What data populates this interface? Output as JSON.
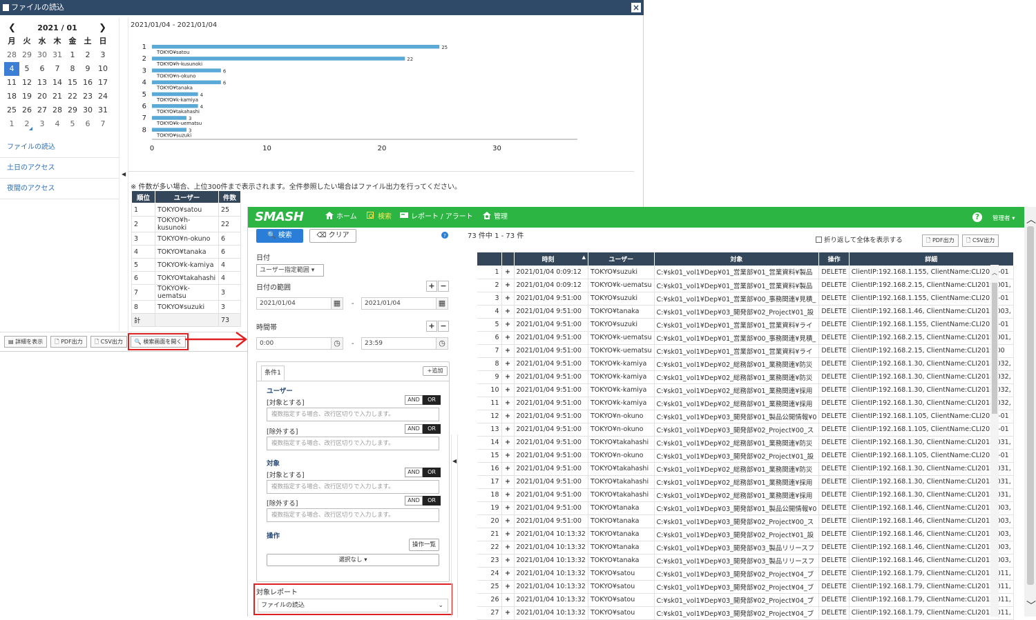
{
  "report_window": {
    "title": "ファイルの読込",
    "close": "×",
    "calendar": {
      "month_label": "2021 / 01",
      "prev": "❮",
      "next": "❯",
      "weekdays": [
        "月",
        "火",
        "水",
        "木",
        "金",
        "土",
        "日"
      ],
      "days": [
        {
          "d": "28",
          "m": true
        },
        {
          "d": "29",
          "m": true
        },
        {
          "d": "30",
          "m": true
        },
        {
          "d": "31",
          "m": true
        },
        {
          "d": "1"
        },
        {
          "d": "2"
        },
        {
          "d": "3"
        },
        {
          "d": "4",
          "sel": true
        },
        {
          "d": "5"
        },
        {
          "d": "6"
        },
        {
          "d": "7"
        },
        {
          "d": "8"
        },
        {
          "d": "9"
        },
        {
          "d": "10"
        },
        {
          "d": "11"
        },
        {
          "d": "12"
        },
        {
          "d": "13"
        },
        {
          "d": "14"
        },
        {
          "d": "15"
        },
        {
          "d": "16"
        },
        {
          "d": "17"
        },
        {
          "d": "18"
        },
        {
          "d": "19"
        },
        {
          "d": "20"
        },
        {
          "d": "21"
        },
        {
          "d": "22"
        },
        {
          "d": "23"
        },
        {
          "d": "24"
        },
        {
          "d": "25"
        },
        {
          "d": "26"
        },
        {
          "d": "27"
        },
        {
          "d": "28"
        },
        {
          "d": "29"
        },
        {
          "d": "30"
        },
        {
          "d": "31"
        },
        {
          "d": "1",
          "m": true
        },
        {
          "d": "2",
          "m": true,
          "mark": true
        },
        {
          "d": "3",
          "m": true
        },
        {
          "d": "4",
          "m": true
        },
        {
          "d": "5",
          "m": true
        },
        {
          "d": "6",
          "m": true
        },
        {
          "d": "7",
          "m": true
        }
      ]
    },
    "side_links": [
      "ファイルの読込",
      "土日のアクセス",
      "夜間のアクセス"
    ],
    "date_range": "2021/01/04 - 2021/01/04",
    "note": "※ 件数が多い場合、上位300件まで表示されます。全件参照したい場合はファイル出力を行ってください。",
    "rank_table": {
      "headers": [
        "順位",
        "ユーザー",
        "件数"
      ],
      "rows": [
        [
          "1",
          "TOKYO¥satou",
          "25"
        ],
        [
          "2",
          "TOKYO¥h-kusunoki",
          "22"
        ],
        [
          "3",
          "TOKYO¥n-okuno",
          "6"
        ],
        [
          "4",
          "TOKYO¥tanaka",
          "6"
        ],
        [
          "5",
          "TOKYO¥k-kamiya",
          "4"
        ],
        [
          "6",
          "TOKYO¥takahashi",
          "4"
        ],
        [
          "7",
          "TOKYO¥k-uematsu",
          "3"
        ],
        [
          "8",
          "TOKYO¥suzuki",
          "3"
        ]
      ],
      "total_label": "計",
      "total_value": "73"
    },
    "buttons": {
      "detail": "詳細を表示",
      "pdf": "PDF出力",
      "csv": "CSV出力",
      "open_search": "検索画面を開く"
    }
  },
  "chart_data": {
    "type": "bar",
    "orientation": "horizontal",
    "categories": [
      "1",
      "2",
      "3",
      "4",
      "5",
      "6",
      "7",
      "8"
    ],
    "bar_labels": [
      "TOKYO¥satou",
      "TOKYO¥h-kusunoki",
      "TOKYO¥n-okuno",
      "TOKYO¥tanaka",
      "TOKYO¥k-kamiya",
      "TOKYO¥takahashi",
      "TOKYO¥k-uematsu",
      "TOKYO¥suzuki"
    ],
    "values": [
      25,
      22,
      6,
      6,
      4,
      4,
      3,
      3
    ],
    "xlim": [
      0,
      37
    ],
    "xticks": [
      0,
      10,
      20,
      30
    ],
    "bar_color": "#5aa9d6",
    "grid": false
  },
  "app": {
    "logo": "SMASH",
    "nav": {
      "home": "ホーム",
      "search": "検索",
      "report": "レポート / アラート",
      "admin_menu": "管理",
      "help": "?",
      "user": "管理者 ▾"
    },
    "form": {
      "search_btn": "検索",
      "clear_btn": "クリア",
      "date_label": "日付",
      "date_mode": "ユーザー指定範囲",
      "date_range_label": "日付の範囲",
      "date_from": "2021/01/04",
      "date_to": "2021/01/04",
      "range_sep": "-",
      "time_label": "時間帯",
      "time_from": "0:00",
      "time_to": "23:59",
      "cond_tab": "条件1",
      "add_btn": "追加",
      "user_section": "ユーザー",
      "target_section": "対象",
      "op_section": "操作",
      "include_label": "[対象とする]",
      "exclude_label": "[除外する]",
      "and": "AND",
      "or": "OR",
      "multi_placeholder": "複数指定する場合、改行区切りで入力します。",
      "op_list_btn": "操作一覧",
      "op_select": "選択なし ▾",
      "report_label": "対象レポート",
      "report_value": "ファイルの読込"
    },
    "results": {
      "count_text": "73 件中 1 - 73 件",
      "wrap_label": "折り返して全体を表示する",
      "pdf": "PDF出力",
      "csv": "CSV出力",
      "headers": [
        "",
        "",
        "時刻",
        "ユーザー",
        "対象",
        "操作",
        "詳細"
      ],
      "rows": [
        [
          "1",
          "2021/01/04 0:09:12",
          "TOKYO¥suzuki",
          "C:¥sk01_vol1¥Dep¥01_営業部¥01_営業資料¥製品",
          "DELETE",
          "ClientIP:192.168.1.155, ClientName:CLI2016-01"
        ],
        [
          "2",
          "2021/01/04 0:09:12",
          "TOKYO¥k-uematsu",
          "C:¥sk01_vol1¥Dep¥01_営業部¥01_営業資料¥製品",
          "DELETE",
          "ClientIP:192.168.2.15, ClientName:CLI2019-001,"
        ],
        [
          "3",
          "2021/01/04 9:51:00",
          "TOKYO¥suzuki",
          "C:¥sk01_vol1¥Dep¥01_営業部¥00_事務関連¥見積_",
          "DELETE",
          "ClientIP:192.168.1.155, ClientName:CLI2016-01"
        ],
        [
          "4",
          "2021/01/04 9:51:00",
          "TOKYO¥tanaka",
          "C:¥sk01_vol1¥Dep¥03_開発部¥02_Project¥01_設",
          "DELETE",
          "ClientIP:192.168.1.46, ClientName:CLI2015-003,"
        ],
        [
          "5",
          "2021/01/04 9:51:00",
          "TOKYO¥suzuki",
          "C:¥sk01_vol1¥Dep¥01_営業部¥01_営業資料¥ライ",
          "DELETE",
          "ClientIP:192.168.1.155, ClientName:CLI2016-01"
        ],
        [
          "6",
          "2021/01/04 9:51:00",
          "TOKYO¥k-uematsu",
          "C:¥sk01_vol1¥Dep¥01_営業部¥00_事務関連¥見積_",
          "DELETE",
          "ClientIP:192.168.2.15, ClientName:CLI2019-001,"
        ],
        [
          "7",
          "2021/01/04 9:51:00",
          "TOKYO¥k-uematsu",
          "C:¥sk01_vol1¥Dep¥01_営業部¥01_営業資料¥ライ",
          "DELETE",
          "ClientIP:192.168.2.15, ClientName:CLI2019-00"
        ],
        [
          "8",
          "2021/01/04 9:51:00",
          "TOKYO¥k-kamiya",
          "C:¥sk01_vol1¥Dep¥02_総務部¥01_業務関連¥防災",
          "DELETE",
          "ClientIP:192.168.1.30, ClientName:CLI2018-032,"
        ],
        [
          "9",
          "2021/01/04 9:51:00",
          "TOKYO¥k-kamiya",
          "C:¥sk01_vol1¥Dep¥02_総務部¥01_業務関連¥防災",
          "DELETE",
          "ClientIP:192.168.1.30, ClientName:CLI2018-032,"
        ],
        [
          "10",
          "2021/01/04 9:51:00",
          "TOKYO¥k-kamiya",
          "C:¥sk01_vol1¥Dep¥02_総務部¥01_業務関連¥採用",
          "DELETE",
          "ClientIP:192.168.1.30, ClientName:CLI2018-032,"
        ],
        [
          "11",
          "2021/01/04 9:51:00",
          "TOKYO¥k-kamiya",
          "C:¥sk01_vol1¥Dep¥02_総務部¥01_業務関連¥採用",
          "DELETE",
          "ClientIP:192.168.1.30, ClientName:CLI2018-032,"
        ],
        [
          "12",
          "2021/01/04 9:51:00",
          "TOKYO¥n-okuno",
          "C:¥sk01_vol1¥Dep¥03_開発部¥01_製品公開情報¥0",
          "DELETE",
          "ClientIP:192.168.1.105, ClientName:CLI2019-01"
        ],
        [
          "13",
          "2021/01/04 9:51:00",
          "TOKYO¥n-okuno",
          "C:¥sk01_vol1¥Dep¥03_開発部¥02_Project¥00_ス",
          "DELETE",
          "ClientIP:192.168.1.105, ClientName:CLI2019-01"
        ],
        [
          "14",
          "2021/01/04 9:51:00",
          "TOKYO¥takahashi",
          "C:¥sk01_vol1¥Dep¥02_総務部¥01_業務関連¥防災",
          "DELETE",
          "ClientIP:192.168.1.30, ClientName:CLI2018-031,"
        ],
        [
          "15",
          "2021/01/04 9:51:00",
          "TOKYO¥n-okuno",
          "C:¥sk01_vol1¥Dep¥03_開発部¥02_Project¥01_設",
          "DELETE",
          "ClientIP:192.168.1.105, ClientName:CLI2019-01"
        ],
        [
          "16",
          "2021/01/04 9:51:00",
          "TOKYO¥takahashi",
          "C:¥sk01_vol1¥Dep¥02_総務部¥01_業務関連¥防災",
          "DELETE",
          "ClientIP:192.168.1.30, ClientName:CLI2018-031,"
        ],
        [
          "17",
          "2021/01/04 9:51:00",
          "TOKYO¥takahashi",
          "C:¥sk01_vol1¥Dep¥02_総務部¥01_業務関連¥採用",
          "DELETE",
          "ClientIP:192.168.1.30, ClientName:CLI2018-031,"
        ],
        [
          "18",
          "2021/01/04 9:51:00",
          "TOKYO¥takahashi",
          "C:¥sk01_vol1¥Dep¥02_総務部¥01_業務関連¥採用",
          "DELETE",
          "ClientIP:192.168.1.30, ClientName:CLI2018-031,"
        ],
        [
          "19",
          "2021/01/04 9:51:00",
          "TOKYO¥tanaka",
          "C:¥sk01_vol1¥Dep¥03_開発部¥01_製品公開情報¥0",
          "DELETE",
          "ClientIP:192.168.1.46, ClientName:CLI2015-003,"
        ],
        [
          "20",
          "2021/01/04 9:51:00",
          "TOKYO¥tanaka",
          "C:¥sk01_vol1¥Dep¥03_開発部¥02_Project¥00_ス",
          "DELETE",
          "ClientIP:192.168.1.46, ClientName:CLI2015-003,"
        ],
        [
          "21",
          "2021/01/04 10:13:32",
          "TOKYO¥tanaka",
          "C:¥sk01_vol1¥Dep¥03_開発部¥02_Project¥01_設",
          "DELETE",
          "ClientIP:192.168.1.46, ClientName:CLI2015-003,"
        ],
        [
          "22",
          "2021/01/04 10:13:32",
          "TOKYO¥tanaka",
          "C:¥sk01_vol1¥Dep¥03_開発部¥03_製品リリースフ",
          "DELETE",
          "ClientIP:192.168.1.46, ClientName:CLI2015-003,"
        ],
        [
          "23",
          "2021/01/04 10:13:32",
          "TOKYO¥tanaka",
          "C:¥sk01_vol1¥Dep¥03_開発部¥03_製品リリースフ",
          "DELETE",
          "ClientIP:192.168.1.46, ClientName:CLI2015-003,"
        ],
        [
          "24",
          "2021/01/04 10:13:32",
          "TOKYO¥satou",
          "C:¥sk01_vol1¥Dep¥03_開発部¥02_Project¥04_ブ",
          "DELETE",
          "ClientIP:192.168.1.79, ClientName:CLI2015-011,"
        ],
        [
          "25",
          "2021/01/04 10:13:32",
          "TOKYO¥satou",
          "C:¥sk01_vol1¥Dep¥03_開発部¥02_Project¥04_ブ",
          "DELETE",
          "ClientIP:192.168.1.79, ClientName:CLI2015-011,"
        ],
        [
          "26",
          "2021/01/04 10:13:32",
          "TOKYO¥satou",
          "C:¥sk01_vol1¥Dep¥03_開発部¥02_Project¥04_ブ",
          "DELETE",
          "ClientIP:192.168.1.79, ClientName:CLI2015-011,"
        ],
        [
          "27",
          "2021/01/04 10:13:32",
          "TOKYO¥satou",
          "C:¥sk01_vol1¥Dep¥03_開発部¥02_Project¥04_ブ",
          "DELETE",
          "ClientIP:192.168.1.79, ClientName:CLI2015-011,"
        ]
      ]
    }
  },
  "colors": {
    "nav_green": "#2db544",
    "header_navy": "#34465a",
    "title_navy": "#2f4a68",
    "accent_blue": "#2b7ed8",
    "highlight_red": "#e02020"
  }
}
